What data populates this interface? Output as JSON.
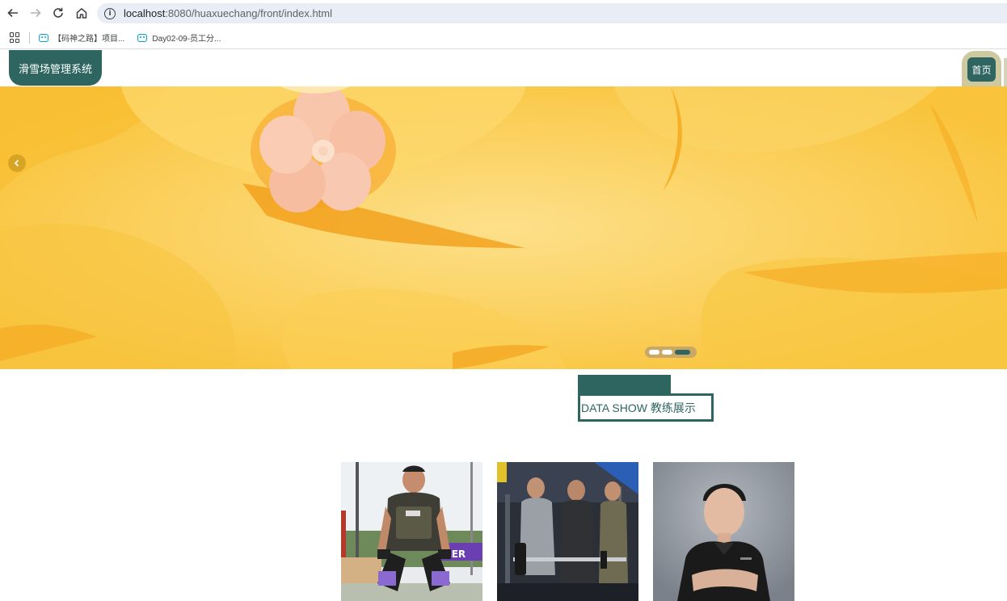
{
  "browser": {
    "url_host": "localhost",
    "url_rest": ":8080/huaxuechang/front/index.html",
    "bookmarks": [
      {
        "label": "【码神之路】项目...",
        "icon": "bilibili-icon"
      },
      {
        "label": "Day02-09-员工分...",
        "icon": "bilibili-icon"
      }
    ]
  },
  "site": {
    "logo": "滑雪场管理系统",
    "nav": {
      "home": "首页"
    }
  },
  "carousel": {
    "slide_count": 3,
    "active_index": 2
  },
  "section": {
    "title": "DATA SHOW 教练展示"
  },
  "coaches": [
    {
      "photo": "coach-photo-weightlifting"
    },
    {
      "photo": "coach-photo-gym-training"
    },
    {
      "photo": "coach-photo-portrait"
    }
  ],
  "colors": {
    "primary": "#2e6560",
    "nav_accent": "#cfc9a0",
    "banner": "#fbd15b"
  }
}
